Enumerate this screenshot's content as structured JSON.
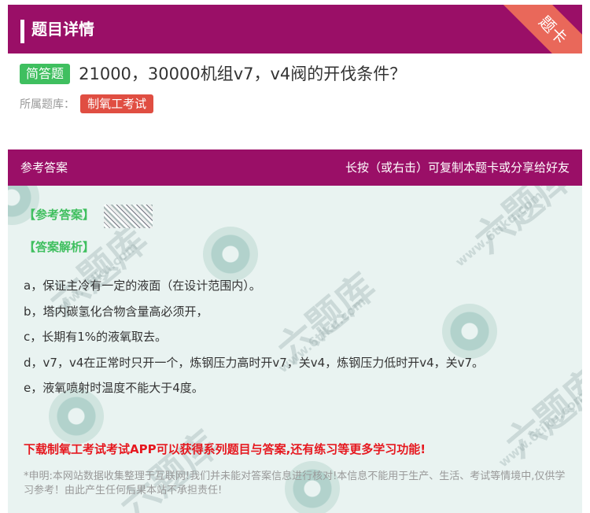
{
  "header": {
    "title": "题目详情",
    "ribbon": "题卡"
  },
  "question": {
    "type_badge": "简答题",
    "text": "21000，30000机组v7，v4阀的开伐条件？",
    "bank_label": "所属题库：",
    "bank_name": "制氧工考试"
  },
  "answer_header": {
    "left": "参考答案",
    "right": "长按（或右击）可复制本题卡或分享给好友"
  },
  "answer": {
    "ref_label": "【参考答案】",
    "analysis_label": "【答案解析】",
    "lines": [
      "a，保证主冷有一定的液面（在设计范围内）。",
      "b，塔内碳氢化合物含量高必须开，",
      "c，长期有1%的液氧取去。",
      "d，v7，v4在正常时只开一个，炼钢压力高时开v7，关v4，炼钢压力低时开v4，关v7。",
      "e，液氧喷射时温度不能大于4度。"
    ],
    "promo": "下载制氧工考试考试APP可以获得系列题目与答案,还有练习等更多学习功能!",
    "disclaimer": "*申明:本网站数据收集整理于互联网!我们并未能对答案信息进行核对!本信息不能用于生产、生活、考试等情境中,仅供学习参考！由此产生任何后果本站不承担责任!"
  },
  "watermark": {
    "big": "六题库",
    "small": "www.6tiku.com"
  },
  "colors": {
    "header": "#9a0f67",
    "ribbon": "#e9685a",
    "badge": "#3fbf5f",
    "tag": "#e04e42",
    "promo": "#e6181f",
    "body_bg": "#e9f3f1"
  }
}
